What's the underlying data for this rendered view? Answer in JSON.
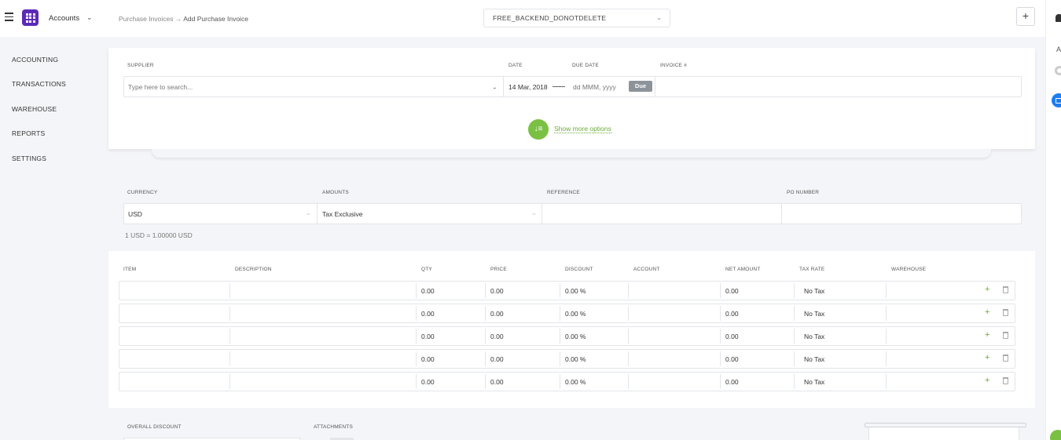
{
  "app": {
    "name": "Accounts"
  },
  "breadcrumb": {
    "parent": "Purchase Invoices",
    "arrow": "→",
    "current": "Add Purchase Invoice"
  },
  "org_selector": {
    "value": "FREE_BACKEND_DONOTDELETE"
  },
  "sidebar": {
    "items": [
      {
        "label": "ACCOUNTING"
      },
      {
        "label": "TRANSACTIONS"
      },
      {
        "label": "WAREHOUSE"
      },
      {
        "label": "REPORTS"
      },
      {
        "label": "SETTINGS"
      }
    ]
  },
  "rightrail": {
    "letter": "A"
  },
  "invoice_header": {
    "supplier_label": "SUPPLIER",
    "supplier_placeholder": "Type here to search...",
    "date_label": "DATE",
    "date_value": "14 Mar, 2018",
    "due_date_label": "DUE DATE",
    "due_date_placeholder": "dd MMM, yyyy",
    "due_badge": "Due",
    "invoice_label": "INVOICE #",
    "invoice_value": "",
    "more_options": "Show more options",
    "more_icon": "↓≡"
  },
  "details": {
    "currency_label": "CURRENCY",
    "currency_value": "USD",
    "amounts_label": "AMOUNTS",
    "amounts_value": "Tax Exclusive",
    "reference_label": "REFERENCE",
    "po_label": "PO NUMBER",
    "rate_note": "1 USD = 1.00000 USD"
  },
  "lines": {
    "headers": {
      "item": "ITEM",
      "description": "DESCRIPTION",
      "qty": "QTY",
      "price": "PRICE",
      "discount": "DISCOUNT",
      "account": "ACCOUNT",
      "net_amount": "NET AMOUNT",
      "tax_rate": "TAX RATE",
      "warehouse": "WAREHOUSE"
    },
    "rows": [
      {
        "qty": "0.00",
        "price": "0.00",
        "discount": "0.00 %",
        "net": "0.00",
        "tax": "No Tax"
      },
      {
        "qty": "0.00",
        "price": "0.00",
        "discount": "0.00 %",
        "net": "0.00",
        "tax": "No Tax"
      },
      {
        "qty": "0.00",
        "price": "0.00",
        "discount": "0.00 %",
        "net": "0.00",
        "tax": "No Tax"
      },
      {
        "qty": "0.00",
        "price": "0.00",
        "discount": "0.00 %",
        "net": "0.00",
        "tax": "No Tax"
      },
      {
        "qty": "0.00",
        "price": "0.00",
        "discount": "0.00 %",
        "net": "0.00",
        "tax": "No Tax"
      }
    ],
    "add_symbol": "+"
  },
  "footer": {
    "overall_discount_label": "OVERALL DISCOUNT",
    "attachments_label": "ATTACHMENTS"
  },
  "toolbar": {
    "plus_symbol": "+"
  },
  "icons": {
    "menu": "hamburger-icon",
    "app": "apps-grid-icon",
    "chevron": "chevron-down-icon",
    "add": "plus-icon",
    "delete": "trash-icon",
    "notifications": "bell-icon",
    "settings": "gear-icon",
    "messages": "mail-icon",
    "chat": "chat-icon"
  },
  "colors": {
    "brand": "#5b2ab6",
    "accent": "#7ac143",
    "badge": "#8d939b",
    "info": "#1b7ef0"
  }
}
